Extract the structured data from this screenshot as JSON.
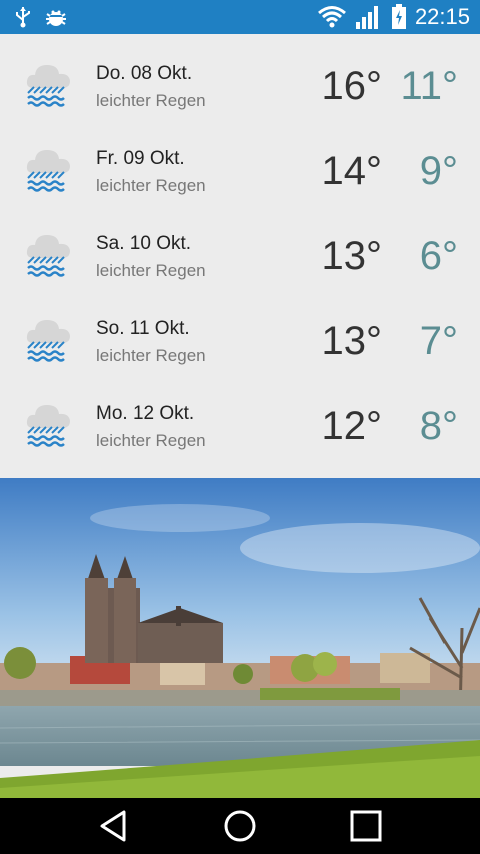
{
  "status_bar": {
    "time": "22:15",
    "left_icons": [
      "usb-icon",
      "android-debug-icon"
    ],
    "right_icons": [
      "wifi-icon",
      "signal-icon",
      "battery-charging-icon"
    ],
    "color": "#1f80c3"
  },
  "forecast": [
    {
      "day": "Do. 08 Okt.",
      "condition": "leichter Regen",
      "high": "16°",
      "low": "11°",
      "icon": "light-rain-icon"
    },
    {
      "day": "Fr. 09 Okt.",
      "condition": "leichter Regen",
      "high": "14°",
      "low": "9°",
      "icon": "light-rain-icon"
    },
    {
      "day": "Sa. 10 Okt.",
      "condition": "leichter Regen",
      "high": "13°",
      "low": "6°",
      "icon": "light-rain-icon"
    },
    {
      "day": "So. 11 Okt.",
      "condition": "leichter Regen",
      "high": "13°",
      "low": "7°",
      "icon": "light-rain-icon"
    },
    {
      "day": "Mo. 12 Okt.",
      "condition": "leichter Regen",
      "high": "12°",
      "low": "8°",
      "icon": "light-rain-icon"
    }
  ],
  "colors": {
    "low_temp": "#5b8d92",
    "rain_drops": "#2a83c8"
  },
  "nav_bar": {
    "buttons": [
      "back-icon",
      "home-icon",
      "recents-icon"
    ]
  }
}
